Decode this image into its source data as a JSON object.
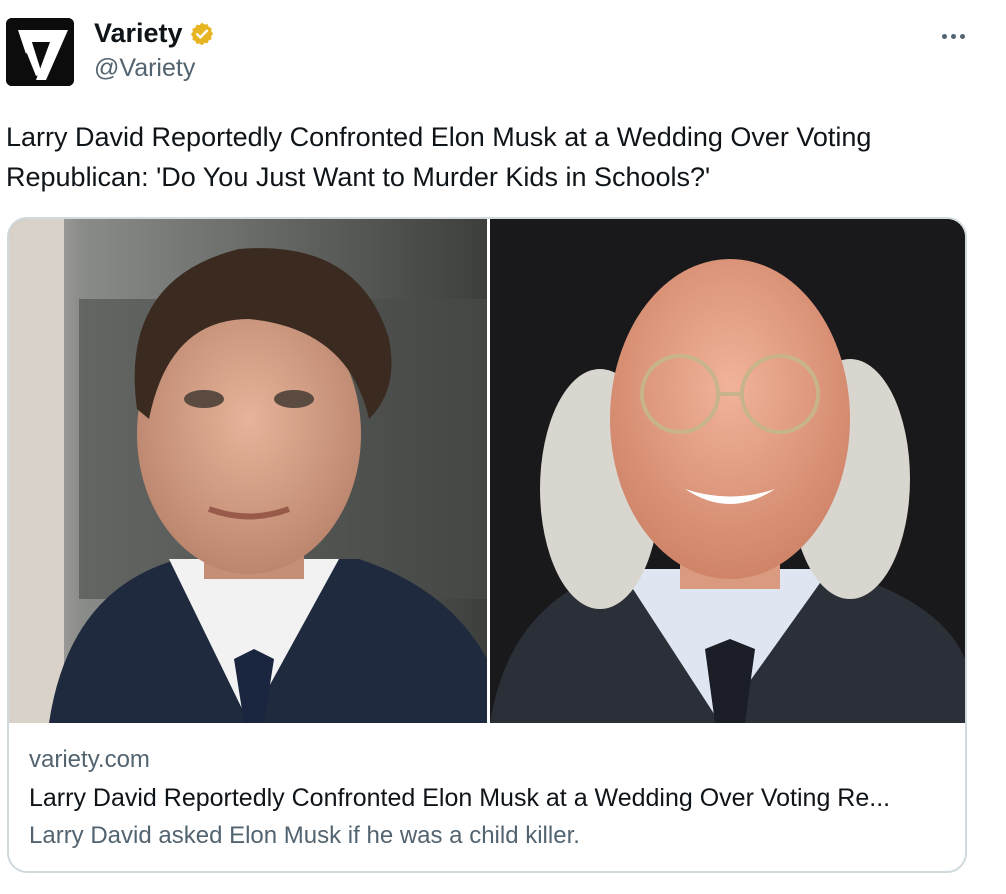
{
  "author": {
    "display_name": "Variety",
    "handle": "@Variety",
    "avatar_letter": "V",
    "verified_icon": "verified-badge-icon",
    "verified_color": "#e7b522"
  },
  "more_icon": "more-options-icon",
  "tweet": {
    "text": "Larry David Reportedly Confronted Elon Musk at a Wedding Over Voting Republican: 'Do You Just Want to Murder Kids in Schools?'"
  },
  "card": {
    "domain": "variety.com",
    "title": "Larry David Reportedly Confronted Elon Musk at a Wedding Over Voting Re...",
    "description": "Larry David asked Elon Musk if he was a child killer."
  },
  "colors": {
    "text_primary": "#0f1419",
    "text_secondary": "#536471",
    "border": "#cfd9de"
  }
}
